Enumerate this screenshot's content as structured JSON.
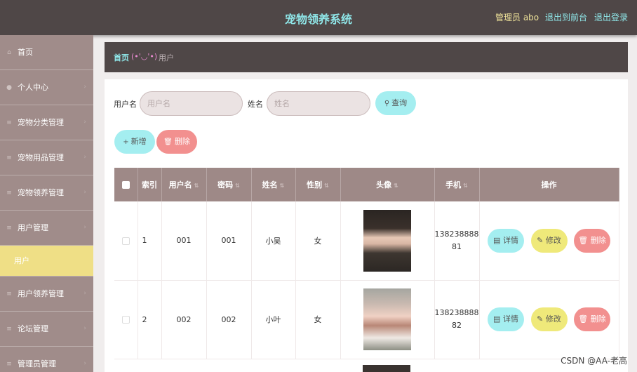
{
  "header": {
    "title": "宠物领养系统",
    "admin": "管理员 abo",
    "to_front": "退出到前台",
    "logout": "退出登录"
  },
  "sidebar": {
    "items": [
      {
        "label": "首页",
        "icon": "home-icon"
      },
      {
        "label": "个人中心",
        "icon": "user-icon"
      },
      {
        "label": "宠物分类管理",
        "icon": "menu-icon"
      },
      {
        "label": "宠物用品管理",
        "icon": "menu-icon"
      },
      {
        "label": "宠物领养管理",
        "icon": "menu-icon"
      },
      {
        "label": "用户管理",
        "icon": "menu-icon"
      },
      {
        "label": "用户",
        "icon": "",
        "active": true
      },
      {
        "label": "用户领养管理",
        "icon": "menu-icon"
      },
      {
        "label": "论坛管理",
        "icon": "menu-icon"
      },
      {
        "label": "管理员管理",
        "icon": "menu-icon"
      }
    ]
  },
  "breadcrumb": {
    "home": "首页",
    "emoji": "(•'◡'•)",
    "current": "用户"
  },
  "search": {
    "username_label": "用户名",
    "username_placeholder": "用户名",
    "name_label": "姓名",
    "name_placeholder": "姓名",
    "query": "查询"
  },
  "actions": {
    "add": "新增",
    "delete": "删除"
  },
  "table": {
    "headers": [
      "索引",
      "用户名",
      "密码",
      "姓名",
      "性别",
      "头像",
      "手机",
      "操作"
    ],
    "rows": [
      {
        "index": "1",
        "username": "001",
        "password": "001",
        "name": "小吴",
        "gender": "女",
        "phone_a": "138238888",
        "phone_b": "81"
      },
      {
        "index": "2",
        "username": "002",
        "password": "002",
        "name": "小叶",
        "gender": "女",
        "phone_a": "138238888",
        "phone_b": "82"
      }
    ],
    "op_detail": "详情",
    "op_edit": "修改",
    "op_delete": "删除"
  },
  "watermark": "CSDN @AA-老高",
  "colors": {
    "topbar": "#4f4747",
    "accent_cyan": "#8fe6e8",
    "sidebar": "#a08c8a",
    "active_item": "#efdf86",
    "table_header": "#9e8987",
    "delete_pink": "#f2908f",
    "edit_yellow": "#efe97a"
  }
}
